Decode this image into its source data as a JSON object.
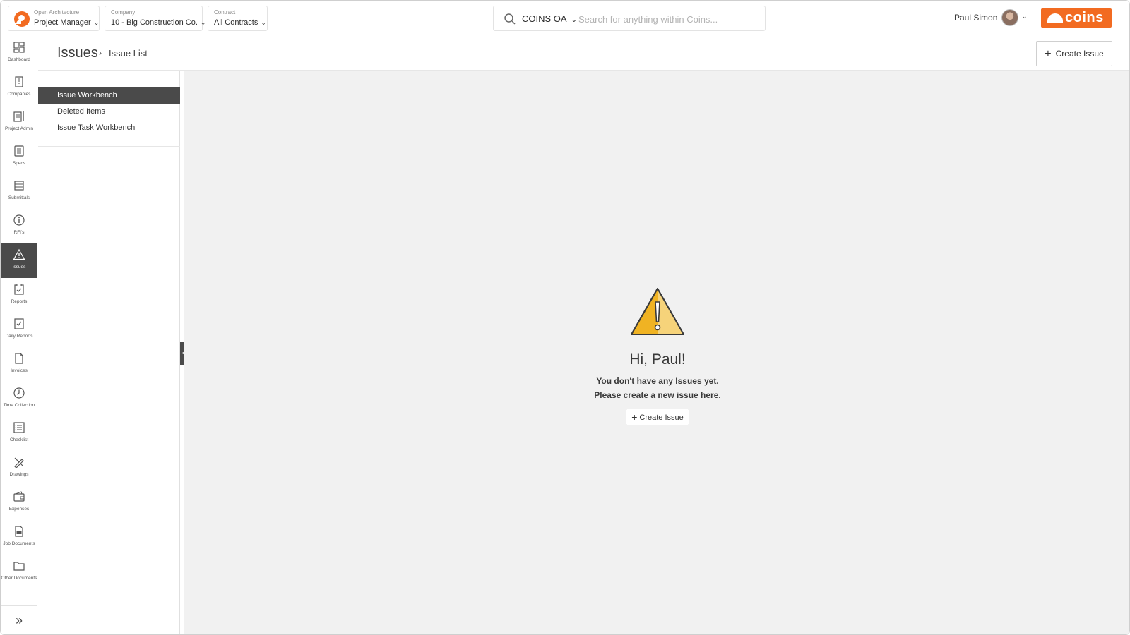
{
  "topbar": {
    "role": {
      "label": "Open Architecture",
      "value": "Project Manager"
    },
    "company": {
      "label": "Company",
      "value": "10 - Big Construction Co."
    },
    "contract": {
      "label": "Contract",
      "value": "All Contracts"
    },
    "search": {
      "scope": "COINS OA",
      "placeholder": "Search for anything within Coins..."
    },
    "user_name": "Paul Simon",
    "brand": "coins",
    "brand_color": "#f26b21"
  },
  "rail": {
    "items": [
      {
        "label": "Dashboard",
        "icon": "dashboard-icon"
      },
      {
        "label": "Companies",
        "icon": "building-icon"
      },
      {
        "label": "Project Admin",
        "icon": "project-admin-icon"
      },
      {
        "label": "Specs",
        "icon": "specs-icon"
      },
      {
        "label": "Submittals",
        "icon": "submittals-icon"
      },
      {
        "label": "RFI's",
        "icon": "info-icon"
      },
      {
        "label": "Issues",
        "icon": "warning-icon",
        "active": true
      },
      {
        "label": "Reports",
        "icon": "reports-icon"
      },
      {
        "label": "Daily Reports",
        "icon": "daily-reports-icon"
      },
      {
        "label": "Invoices",
        "icon": "invoice-icon"
      },
      {
        "label": "Time Collection",
        "icon": "clock-icon"
      },
      {
        "label": "Checklist",
        "icon": "checklist-icon"
      },
      {
        "label": "Drawings",
        "icon": "drawings-icon"
      },
      {
        "label": "Expenses",
        "icon": "wallet-icon"
      },
      {
        "label": "Job Documents",
        "icon": "pdf-document-icon"
      },
      {
        "label": "Other Documents",
        "icon": "folder-icon"
      }
    ],
    "expand": "»"
  },
  "header": {
    "breadcrumb_root": "Issues",
    "breadcrumb_sep": "›",
    "breadcrumb_leaf": "Issue List",
    "create_label": "Create Issue"
  },
  "subnav": {
    "items": [
      {
        "label": "Issue Workbench",
        "active": true
      },
      {
        "label": "Deleted Items"
      },
      {
        "label": "Issue Task Workbench"
      }
    ]
  },
  "empty_state": {
    "title": "Hi, Paul!",
    "line1": "You don't have any Issues yet.",
    "line2": "Please create a new issue here.",
    "button_label": "Create Issue",
    "icon": "warning-triangle-icon",
    "icon_color": "#f0b323"
  }
}
